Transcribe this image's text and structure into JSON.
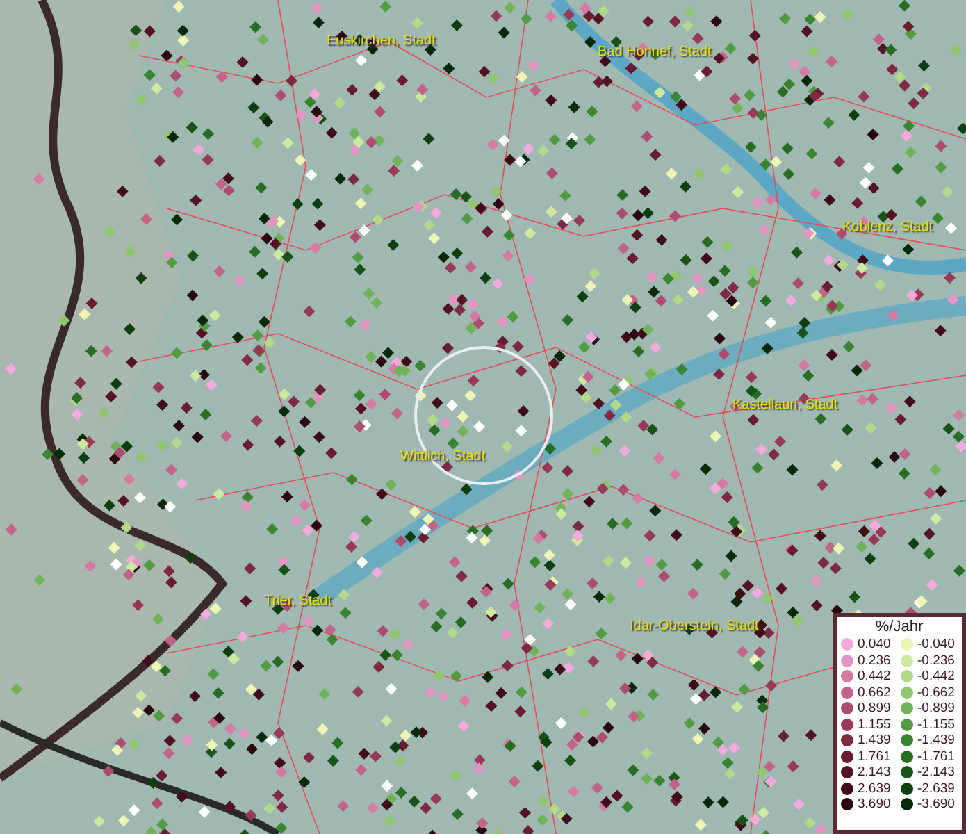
{
  "map": {
    "places": [
      {
        "name": "Euskirchen, Stadt"
      },
      {
        "name": "Bad Honnef, Stadt"
      },
      {
        "name": "Koblenz, Stadt"
      },
      {
        "name": "Kastellaun, Stadt"
      },
      {
        "name": "Wittlich, Stadt"
      },
      {
        "name": "Trier, Stadt"
      },
      {
        "name": "Idar-Oberstein, Stadt"
      }
    ]
  },
  "legend": {
    "title": "%/Jahr",
    "entries": [
      {
        "label": "0.040",
        "color": "#f2a9dc"
      },
      {
        "label": "-0.040",
        "color": "#eef5b4"
      },
      {
        "label": "0.236",
        "color": "#e495c4"
      },
      {
        "label": "-0.236",
        "color": "#cfe8a0"
      },
      {
        "label": "0.442",
        "color": "#d47aa4"
      },
      {
        "label": "-0.442",
        "color": "#b2d98a"
      },
      {
        "label": "0.662",
        "color": "#c2638a"
      },
      {
        "label": "-0.662",
        "color": "#8fc66e"
      },
      {
        "label": "0.899",
        "color": "#ad4c70"
      },
      {
        "label": "-0.899",
        "color": "#6fb257"
      },
      {
        "label": "1.155",
        "color": "#963a58"
      },
      {
        "label": "-1.155",
        "color": "#529b42"
      },
      {
        "label": "1.439",
        "color": "#7e2a43"
      },
      {
        "label": "-1.439",
        "color": "#3a8532"
      },
      {
        "label": "1.761",
        "color": "#6a1d32"
      },
      {
        "label": "-1.761",
        "color": "#276d24"
      },
      {
        "label": "2.143",
        "color": "#551424"
      },
      {
        "label": "-2.143",
        "color": "#185418"
      },
      {
        "label": "2.639",
        "color": "#400c18"
      },
      {
        "label": "-2.639",
        "color": "#0e3f10"
      },
      {
        "label": "3.690",
        "color": "#2a060e"
      },
      {
        "label": "-3.690",
        "color": "#062a08"
      }
    ]
  }
}
